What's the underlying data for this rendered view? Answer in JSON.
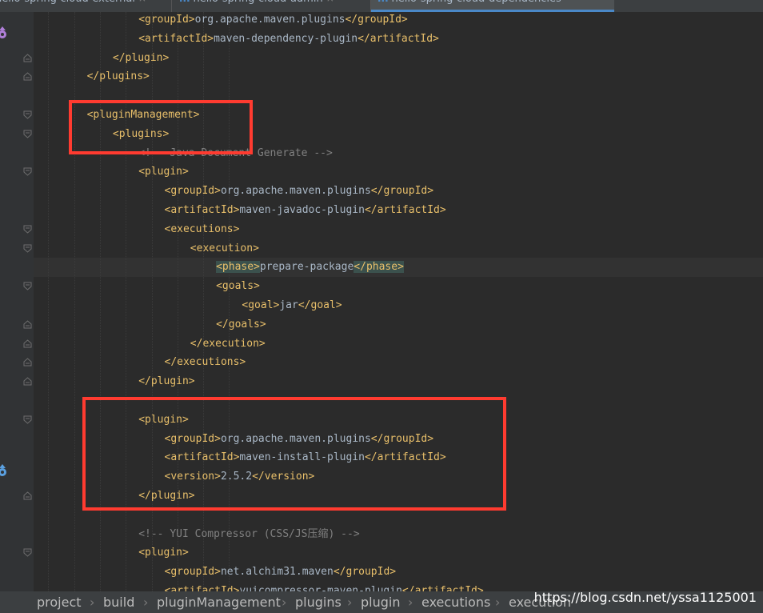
{
  "tabs": [
    {
      "label": "hello-spring-cloud-external",
      "close": "×"
    },
    {
      "label": "hello-spring-cloud-admin",
      "close": "×"
    },
    {
      "label": "hello-spring-cloud-dependencies",
      "close": ""
    }
  ],
  "tab_icon": "m",
  "code_lines": [
    {
      "indent": 4,
      "text": "",
      "parts": [
        {
          "t": "tag",
          "v": "<groupId>"
        },
        {
          "t": "text",
          "v": "org.apache.maven.plugins"
        },
        {
          "t": "tag",
          "v": "</groupId>"
        }
      ]
    },
    {
      "indent": 4,
      "parts": [
        {
          "t": "tag",
          "v": "<artifactId>"
        },
        {
          "t": "text",
          "v": "maven-dependency-plugin"
        },
        {
          "t": "tag",
          "v": "</artifactId>"
        }
      ]
    },
    {
      "indent": 3,
      "parts": [
        {
          "t": "tag",
          "v": "</plugin>"
        }
      ]
    },
    {
      "indent": 2,
      "parts": [
        {
          "t": "tag",
          "v": "</plugins>"
        }
      ]
    },
    {
      "indent": 0,
      "parts": []
    },
    {
      "indent": 2,
      "parts": [
        {
          "t": "tag",
          "v": "<pluginManagement>"
        }
      ]
    },
    {
      "indent": 3,
      "parts": [
        {
          "t": "tag",
          "v": "<plugins>"
        }
      ]
    },
    {
      "indent": 4,
      "parts": [
        {
          "t": "comment",
          "v": "<!-- Java Document Generate -->"
        }
      ]
    },
    {
      "indent": 4,
      "parts": [
        {
          "t": "tag",
          "v": "<plugin>"
        }
      ]
    },
    {
      "indent": 5,
      "parts": [
        {
          "t": "tag",
          "v": "<groupId>"
        },
        {
          "t": "text",
          "v": "org.apache.maven.plugins"
        },
        {
          "t": "tag",
          "v": "</groupId>"
        }
      ]
    },
    {
      "indent": 5,
      "parts": [
        {
          "t": "tag",
          "v": "<artifactId>"
        },
        {
          "t": "text",
          "v": "maven-javadoc-plugin"
        },
        {
          "t": "tag",
          "v": "</artifactId>"
        }
      ]
    },
    {
      "indent": 5,
      "parts": [
        {
          "t": "tag",
          "v": "<executions>"
        }
      ]
    },
    {
      "indent": 6,
      "parts": [
        {
          "t": "tag",
          "v": "<execution>"
        }
      ]
    },
    {
      "indent": 7,
      "parts": [
        {
          "t": "tag_hl",
          "v": "<phase>"
        },
        {
          "t": "text",
          "v": "prepare-package"
        },
        {
          "t": "tag_hl",
          "v": "</phase>"
        }
      ]
    },
    {
      "indent": 7,
      "parts": [
        {
          "t": "tag",
          "v": "<goals>"
        }
      ]
    },
    {
      "indent": 8,
      "parts": [
        {
          "t": "tag",
          "v": "<goal>"
        },
        {
          "t": "text",
          "v": "jar"
        },
        {
          "t": "tag",
          "v": "</goal>"
        }
      ]
    },
    {
      "indent": 7,
      "parts": [
        {
          "t": "tag",
          "v": "</goals>"
        }
      ]
    },
    {
      "indent": 6,
      "parts": [
        {
          "t": "tag",
          "v": "</execution>"
        }
      ]
    },
    {
      "indent": 5,
      "parts": [
        {
          "t": "tag",
          "v": "</executions>"
        }
      ]
    },
    {
      "indent": 4,
      "parts": [
        {
          "t": "tag",
          "v": "</plugin>"
        }
      ]
    },
    {
      "indent": 0,
      "parts": []
    },
    {
      "indent": 4,
      "parts": [
        {
          "t": "tag",
          "v": "<plugin>"
        }
      ]
    },
    {
      "indent": 5,
      "parts": [
        {
          "t": "tag",
          "v": "<groupId>"
        },
        {
          "t": "text",
          "v": "org.apache.maven.plugins"
        },
        {
          "t": "tag",
          "v": "</groupId>"
        }
      ]
    },
    {
      "indent": 5,
      "parts": [
        {
          "t": "tag",
          "v": "<artifactId>"
        },
        {
          "t": "text",
          "v": "maven-install-plugin"
        },
        {
          "t": "tag",
          "v": "</artifactId>"
        }
      ]
    },
    {
      "indent": 5,
      "parts": [
        {
          "t": "tag",
          "v": "<version>"
        },
        {
          "t": "text",
          "v": "2.5.2"
        },
        {
          "t": "tag",
          "v": "</version>"
        }
      ]
    },
    {
      "indent": 4,
      "parts": [
        {
          "t": "tag",
          "v": "</plugin>"
        }
      ]
    },
    {
      "indent": 0,
      "parts": []
    },
    {
      "indent": 4,
      "parts": [
        {
          "t": "comment",
          "v": "<!-- YUI Compressor (CSS/JS压缩) -->"
        }
      ]
    },
    {
      "indent": 4,
      "parts": [
        {
          "t": "tag",
          "v": "<plugin>"
        }
      ]
    },
    {
      "indent": 5,
      "parts": [
        {
          "t": "tag",
          "v": "<groupId>"
        },
        {
          "t": "text",
          "v": "net.alchim31.maven"
        },
        {
          "t": "tag",
          "v": "</groupId>"
        }
      ]
    },
    {
      "indent": 5,
      "parts": [
        {
          "t": "tag",
          "v": "<artifactId>"
        },
        {
          "t": "text",
          "v": "yuicompressor-maven-plugin"
        },
        {
          "t": "tag",
          "v": "</artifactId>"
        }
      ]
    }
  ],
  "caret_line": 13,
  "fold_markers": [
    {
      "line": 2,
      "kind": "end"
    },
    {
      "line": 3,
      "kind": "end"
    },
    {
      "line": 5,
      "kind": "start"
    },
    {
      "line": 6,
      "kind": "start"
    },
    {
      "line": 8,
      "kind": "start"
    },
    {
      "line": 11,
      "kind": "start"
    },
    {
      "line": 12,
      "kind": "start"
    },
    {
      "line": 14,
      "kind": "start"
    },
    {
      "line": 16,
      "kind": "end"
    },
    {
      "line": 17,
      "kind": "end"
    },
    {
      "line": 18,
      "kind": "end"
    },
    {
      "line": 19,
      "kind": "end"
    },
    {
      "line": 21,
      "kind": "start"
    },
    {
      "line": 25,
      "kind": "end"
    },
    {
      "line": 28,
      "kind": "start"
    }
  ],
  "gutter_icons": [
    {
      "line": 0,
      "name": "override-up-icon",
      "color": "#b07fd9"
    },
    {
      "line": 23,
      "name": "override-down-icon",
      "color": "#5aa0e0"
    }
  ],
  "breadcrumb": [
    "project",
    "build",
    "pluginManagement",
    "plugins",
    "plugin",
    "executions",
    "execution"
  ],
  "watermark": "https://blog.csdn.net/yssa1125001",
  "colors": {
    "tag": "#e8bf6a",
    "text": "#a9b7c6",
    "comment": "#808080",
    "annotation_box": "#ff3b30"
  }
}
